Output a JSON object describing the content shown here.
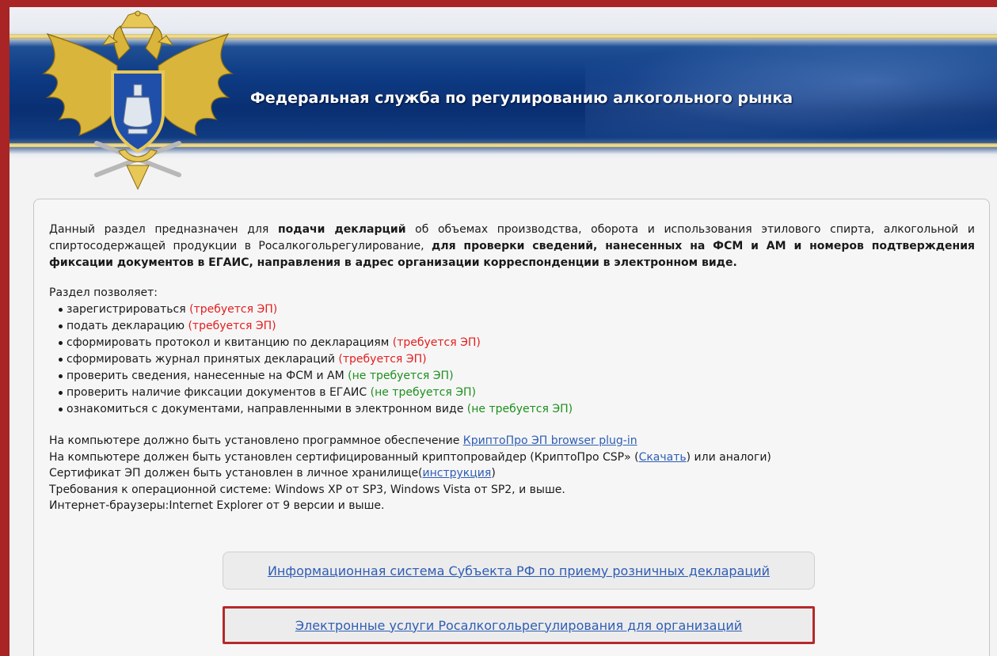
{
  "header": {
    "title": "Федеральная служба по регулированию алкогольного рынка",
    "emblem_icon": "coat-of-arms-icon"
  },
  "intro": {
    "p1_a": "Данный раздел предназначен для ",
    "p1_b": "подачи декларций",
    "p1_c": " об объемах производства, оборота и использования этилового спирта, алкогольной и спиртосодержащей продукции в Росалкогольрегулирование, ",
    "p1_d": "для проверки сведений, нанесенных на ФСМ и АМ и номеров подтверждения фиксации документов в ЕГАИС, направления в адрес организации корреспонденции в электронном виде."
  },
  "features": {
    "label": "Раздел позволяет:",
    "items": [
      {
        "text": "зарегистрироваться ",
        "note": "(требуется ЭП)"
      },
      {
        "text": "подать декларацию ",
        "note": "(требуется ЭП)"
      },
      {
        "text": "сформировать протокол и квитанцию по декларациям ",
        "note": "(требуется ЭП)"
      },
      {
        "text": "сформировать журнал принятых деклараций ",
        "note": "(требуется ЭП)"
      },
      {
        "text": "проверить сведения, нанесенные на ФСМ и АМ ",
        "note": "(не требуется ЭП)"
      },
      {
        "text": "проверить наличие фиксации документов в ЕГАИС ",
        "note": "(не требуется ЭП)"
      },
      {
        "text": "ознакомиться с документами, направленными в электронном виде ",
        "note": "(не требуется ЭП)"
      }
    ]
  },
  "requirements": {
    "line1_text": "На компьютере должно быть установлено программное обеспечение ",
    "line1_link": "КриптоПро ЭП browser plug-in",
    "line2_text": "На компьютере должен быть установлен сертифицированный криптопровайдер (КриптоПро CSP» (",
    "line2_link": "Скачать",
    "line2_tail": ") или аналоги)",
    "line3_text": "Сертификат ЭП должен быть установлен в личное хранилище(",
    "line3_link": "инструкция",
    "line3_tail": ")",
    "line4_text": "Требования к операционной системе: Windows XP от SP3, Windows Vista от SP2, и выше.",
    "line5_text": "Интернет-браузеры:Internet Explorer от 9 версии и выше."
  },
  "buttons": {
    "retail": "Информационная система Субъекта РФ по приему розничных деклараций",
    "eservices": "Электронные услуги Росалкогольрегулирования для организаций"
  },
  "colors": {
    "frame": "#a92424",
    "required": "#e31e1e",
    "not_required": "#1d8f1d",
    "link": "#2f5db4"
  }
}
